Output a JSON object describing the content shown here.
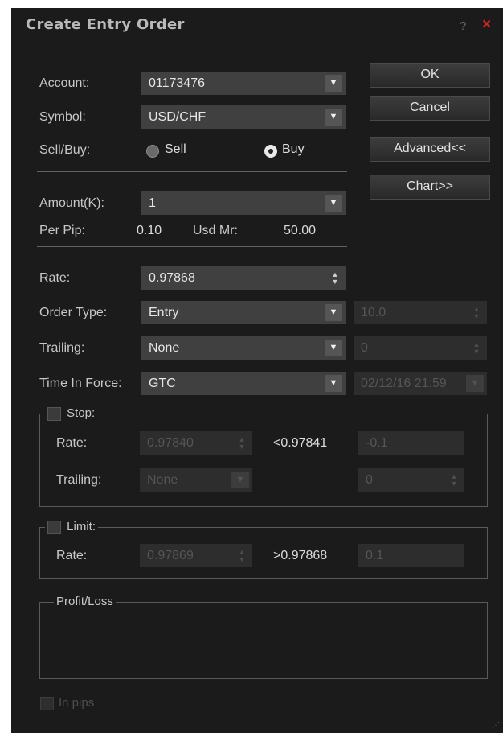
{
  "window": {
    "title": "Create Entry Order",
    "help_label": "?",
    "close_label": "×"
  },
  "account": {
    "label": "Account:",
    "value": "01173476"
  },
  "symbol": {
    "label": "Symbol:",
    "value": "USD/CHF"
  },
  "side": {
    "label": "Sell/Buy:",
    "sell_label": "Sell",
    "buy_label": "Buy",
    "selected": "Buy"
  },
  "amount": {
    "label": "Amount(K):",
    "value": "1"
  },
  "pip": {
    "per_pip_label": "Per Pip:",
    "per_pip_value": "0.10",
    "usd_mr_label": "Usd Mr:",
    "usd_mr_value": "50.00"
  },
  "rate": {
    "label": "Rate:",
    "value": "0.97868"
  },
  "order_type": {
    "label": "Order Type:",
    "value": "Entry",
    "range_value": "10.0"
  },
  "trailing": {
    "label": "Trailing:",
    "value": "None",
    "step_value": "0"
  },
  "time_in_force": {
    "label": "Time In Force:",
    "value": "GTC",
    "expire_value": "02/12/16 21:59"
  },
  "stop": {
    "label": "Stop:",
    "rate_label": "Rate:",
    "rate_value": "0.97840",
    "condition": "<0.97841",
    "pips_value": "-0.1",
    "trailing_label": "Trailing:",
    "trailing_value": "None",
    "trailing_step": "0"
  },
  "limit": {
    "label": "Limit:",
    "rate_label": "Rate:",
    "rate_value": "0.97869",
    "condition": ">0.97868",
    "pips_value": "0.1"
  },
  "profit_loss": {
    "label": "Profit/Loss"
  },
  "in_pips": {
    "label": "In pips"
  },
  "buttons": {
    "ok": "OK",
    "cancel": "Cancel",
    "advanced": "Advanced<<",
    "chart": "Chart>>"
  },
  "icons": {
    "dropdown": "chevron-down-icon",
    "spinner": "spin-arrows-icon",
    "resize": "resize-grip-icon"
  }
}
